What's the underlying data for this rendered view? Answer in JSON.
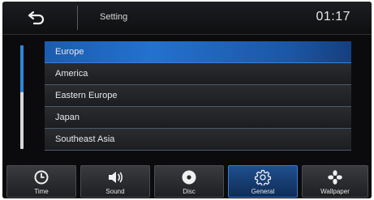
{
  "header": {
    "title": "Setting",
    "clock": "01:17",
    "back_icon": "back-arrow-icon"
  },
  "scrollbar": {
    "position_fraction": 0.0,
    "visible_fraction": 0.45
  },
  "list": {
    "selected_index": 0,
    "items": [
      {
        "label": "Europe"
      },
      {
        "label": "America"
      },
      {
        "label": "Eastern Europe"
      },
      {
        "label": "Japan"
      },
      {
        "label": "Southeast Asia"
      }
    ]
  },
  "tabs": [
    {
      "label": "Time",
      "icon": "clock-icon"
    },
    {
      "label": "Sound",
      "icon": "speaker-icon"
    },
    {
      "label": "Disc",
      "icon": "disc-icon"
    },
    {
      "label": "General",
      "icon": "gear-icon"
    },
    {
      "label": "Wallpaper",
      "icon": "flower-icon"
    }
  ],
  "active_tab_index": 3,
  "colors": {
    "accent": "#2471cf",
    "background": "#0b0b0d",
    "text": "#e8e8e8"
  }
}
